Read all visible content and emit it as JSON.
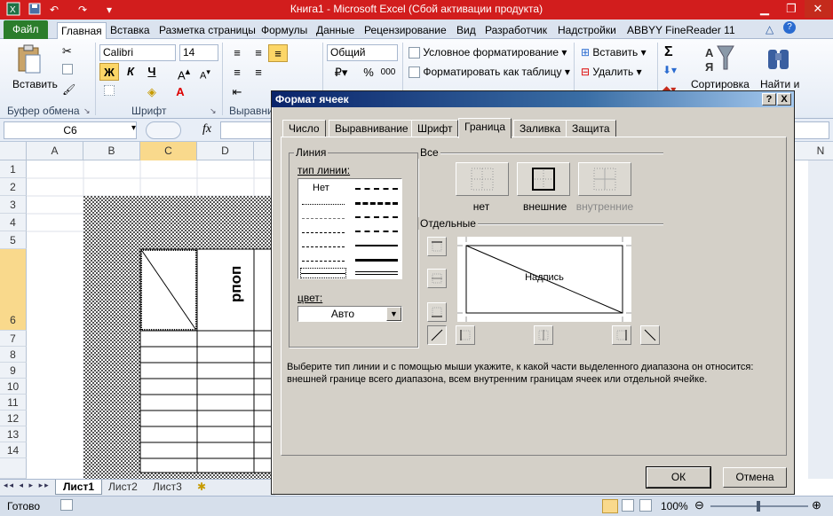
{
  "window": {
    "title": "Книга1  -  Microsoft Excel (Сбой активации продукта)"
  },
  "ribbon_tabs": [
    {
      "label": "Файл"
    },
    {
      "label": "Главная"
    },
    {
      "label": "Вставка"
    },
    {
      "label": "Разметка страницы"
    },
    {
      "label": "Формулы"
    },
    {
      "label": "Данные"
    },
    {
      "label": "Рецензирование"
    },
    {
      "label": "Вид"
    },
    {
      "label": "Разработчик"
    },
    {
      "label": "Надстройки"
    },
    {
      "label": "ABBYY FineReader 11"
    }
  ],
  "ribbon": {
    "paste_label": "Вставить",
    "clipboard_group": "Буфер обмена",
    "font_group": "Шрифт",
    "align_group": "Выравни",
    "font_name": "Calibri",
    "font_size": "14",
    "bold": "Ж",
    "italic": "К",
    "underline": "Ч",
    "number_format": "Общий",
    "percent": "%",
    "thousands": "000",
    "cond_format": "Условное форматирование",
    "format_table": "Форматировать как таблицу",
    "insert": "Вставить",
    "delete": "Удалить",
    "sum": "Σ",
    "sort": "Сортировка",
    "find": "Найти и"
  },
  "formula_bar": {
    "name_box": "C6",
    "fx": "fx"
  },
  "columns": [
    "A",
    "B",
    "C",
    "D"
  ],
  "rows": [
    "1",
    "2",
    "3",
    "4",
    "5",
    "6",
    "7",
    "8",
    "9",
    "10",
    "11",
    "12",
    "13",
    "14"
  ],
  "cell_text": "рпоп",
  "sheet_tabs": [
    "Лист1",
    "Лист2",
    "Лист3"
  ],
  "status": {
    "ready": "Готово",
    "zoom": "100%"
  },
  "dialog": {
    "title": "Формат ячеек",
    "help": "?",
    "close": "X",
    "tabs": [
      "Число",
      "Выравнивание",
      "Шрифт",
      "Граница",
      "Заливка",
      "Защита"
    ],
    "active_tab": "Граница",
    "line_group": "Линия",
    "line_type_label": "тип линии:",
    "line_none": "Нет",
    "color_label": "цвет:",
    "color_value": "Авто",
    "all_group": "Все",
    "presets": [
      "нет",
      "внешние",
      "внутренние"
    ],
    "separate_group": "Отдельные",
    "preview_text": "Надпись",
    "hint": "Выберите тип линии и с помощью мыши укажите, к какой части выделенного диапазона он относится: внешней границе всего диапазона, всем внутренним границам ячеек или отдельной ячейке.",
    "ok": "ОК",
    "cancel": "Отмена"
  }
}
